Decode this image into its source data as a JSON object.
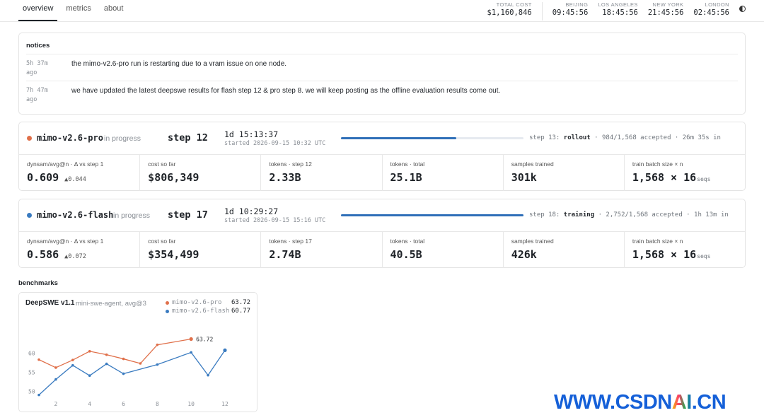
{
  "nav": {
    "tabs": [
      {
        "label": "overview"
      },
      {
        "label": "metrics"
      },
      {
        "label": "about"
      }
    ]
  },
  "header": {
    "total_cost": {
      "label": "TOTAL COST",
      "value": "$1,160,846"
    },
    "clocks": [
      {
        "city": "BEIJING",
        "time": "09:45:56"
      },
      {
        "city": "LOS ANGELES",
        "time": "18:45:56"
      },
      {
        "city": "NEW YORK",
        "time": "21:45:56"
      },
      {
        "city": "LONDON",
        "time": "02:45:56"
      }
    ],
    "theme_icon": "half-circle-icon"
  },
  "notices": {
    "title": "notices",
    "items": [
      {
        "time_line1": "5h 37m",
        "time_line2": "ago",
        "text": "the mimo-v2.6-pro run is restarting due to a vram issue on one node."
      },
      {
        "time_line1": "7h 47m",
        "time_line2": "ago",
        "text": "we have updated the latest deepswe results for flash step 12 & pro step 8. we will keep posting as the offline evaluation results come out."
      }
    ]
  },
  "runs": [
    {
      "name": "mimo-v2.6-pro",
      "color": "#e0704a",
      "status": "in progress",
      "step": "step 12",
      "elapsed": "1d 15:13:37",
      "started": "started 2026-09-15 10:32 UTC",
      "progress": 0.63,
      "next_prefix": "step 13:",
      "next_phase": "rollout",
      "next_suffix": "· 984/1,568 accepted · 26m 35s in",
      "metrics": [
        {
          "label": "dynsam/avg@n · Δ vs step 1",
          "value": "0.609",
          "delta": "▲0.044",
          "unit": ""
        },
        {
          "label": "cost so far",
          "value": "$806,349",
          "delta": "",
          "unit": ""
        },
        {
          "label": "tokens · step 12",
          "value": "2.33B",
          "delta": "",
          "unit": ""
        },
        {
          "label": "tokens · total",
          "value": "25.1B",
          "delta": "",
          "unit": ""
        },
        {
          "label": "samples trained",
          "value": "301k",
          "delta": "",
          "unit": ""
        },
        {
          "label": "train batch size × n",
          "value": "1,568 × 16",
          "delta": "",
          "unit": "seqs"
        }
      ]
    },
    {
      "name": "mimo-v2.6-flash",
      "color": "#3a7bc0",
      "status": "in progress",
      "step": "step 17",
      "elapsed": "1d 10:29:27",
      "started": "started 2026-09-15 15:16 UTC",
      "progress": 1.0,
      "next_prefix": "step 18:",
      "next_phase": "training",
      "next_suffix": "· 2,752/1,568 accepted · 1h 13m in",
      "metrics": [
        {
          "label": "dynsam/avg@n · Δ vs step 1",
          "value": "0.586",
          "delta": "▲0.072",
          "unit": ""
        },
        {
          "label": "cost so far",
          "value": "$354,499",
          "delta": "",
          "unit": ""
        },
        {
          "label": "tokens · step 17",
          "value": "2.74B",
          "delta": "",
          "unit": ""
        },
        {
          "label": "tokens · total",
          "value": "40.5B",
          "delta": "",
          "unit": ""
        },
        {
          "label": "samples trained",
          "value": "426k",
          "delta": "",
          "unit": ""
        },
        {
          "label": "train batch size × n",
          "value": "1,568 × 16",
          "delta": "",
          "unit": "seqs"
        }
      ]
    }
  ],
  "benchmarks": {
    "title": "benchmarks"
  },
  "chart_data": {
    "type": "line",
    "title": "DeepSWE v1.1",
    "subtitle": "mini-swe-agent, avg@3",
    "xlabel": "",
    "ylabel": "",
    "xlim": [
      1,
      12
    ],
    "ylim": [
      48,
      64
    ],
    "xticks": [
      2,
      4,
      6,
      8,
      10,
      12
    ],
    "yticks": [
      50,
      55,
      60
    ],
    "grid": false,
    "legend": "top-right",
    "series": [
      {
        "name": "mimo-v2.6-pro",
        "color": "#e0704a",
        "latest": "63.72",
        "x": [
          1,
          2,
          3,
          4,
          5,
          6,
          7,
          8,
          10
        ],
        "y": [
          58.3,
          56.2,
          58.2,
          60.5,
          59.6,
          58.5,
          57.3,
          62.2,
          63.72
        ]
      },
      {
        "name": "mimo-v2.6-flash",
        "color": "#3a7bc0",
        "latest": "60.77",
        "x": [
          1,
          2,
          3,
          4,
          5,
          6,
          8,
          10,
          11,
          12
        ],
        "y": [
          49.0,
          53.1,
          56.8,
          54.1,
          57.2,
          54.6,
          57.0,
          60.2,
          54.2,
          60.77
        ]
      }
    ],
    "annotations": [
      {
        "series": 0,
        "text": "63.72"
      }
    ]
  },
  "watermark": {
    "prefix": "WWW.CSDN",
    "ai": "AI",
    "suffix": ".CN"
  }
}
